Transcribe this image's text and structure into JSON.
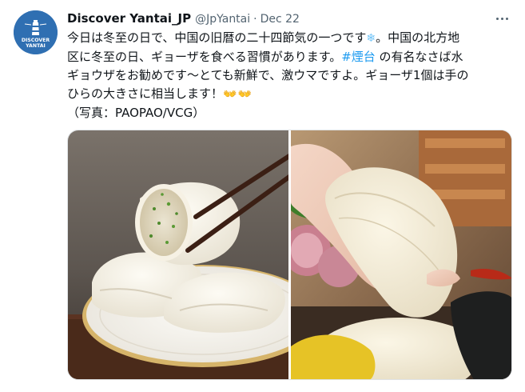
{
  "tweet": {
    "display_name": "Discover Yantai_JP",
    "handle": "@JpYantai",
    "separator": "·",
    "date": "Dec 22",
    "avatar_text_top": "DISCOVER",
    "avatar_text_bottom": "YANTAI",
    "text_lines": [
      {
        "before": "今日は冬至の日で、中国の旧暦の二十四節気の一つです",
        "emoji": "❄",
        "after": "。中国の北方地"
      },
      {
        "before": "区に冬至の日、ギョーザを食べる習慣があります。",
        "hashtag": "#煙台",
        "after": " の有名なさば水"
      },
      {
        "before": "ギョウザをお勧めです～とても新鮮で、激ウマですよ。ギョーザ1個は手の"
      },
      {
        "before": "ひらの大きさに相当します！",
        "emoji": "👐👐"
      },
      {
        "before": "（写真：PAOPAO/VCG）"
      }
    ],
    "more_icon": "more-horizontal-icon",
    "media": [
      {
        "name": "dumpling-chopsticks-photo"
      },
      {
        "name": "dumpling-hand-photo"
      }
    ]
  },
  "colors": {
    "link": "#1d9bf0",
    "muted": "#536471",
    "text": "#0f1419",
    "avatar_bg": "#2f6fb2"
  }
}
